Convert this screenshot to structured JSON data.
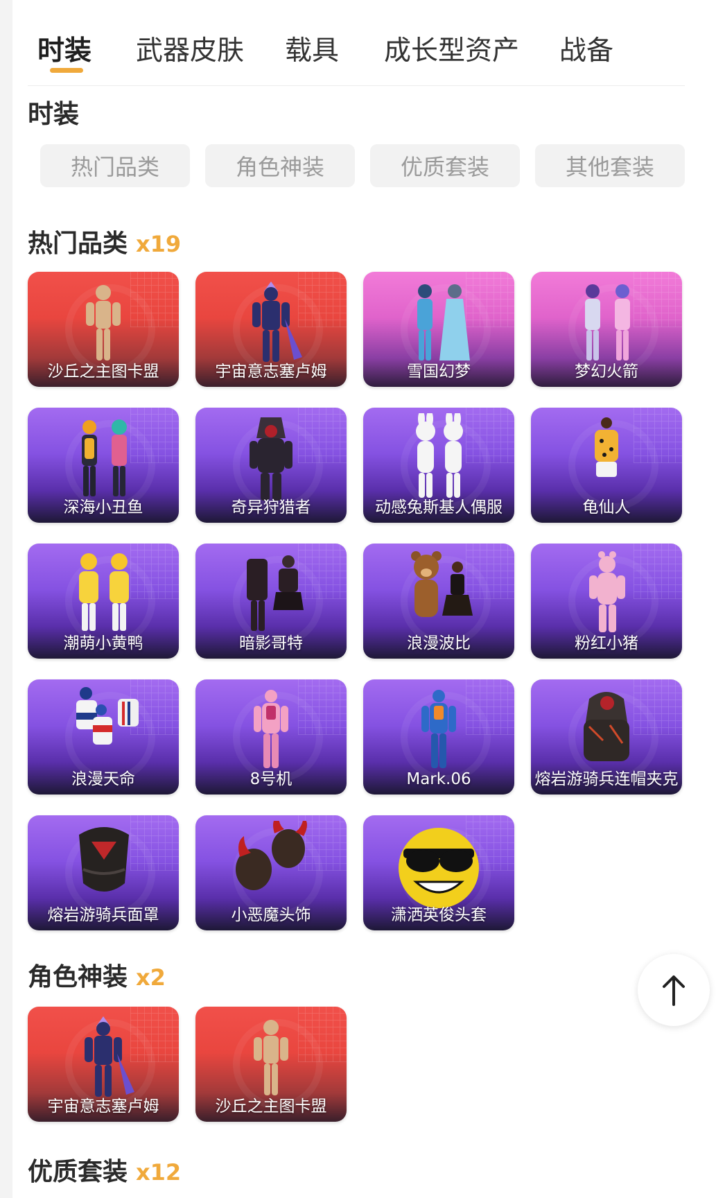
{
  "tabs": [
    {
      "label": "时装",
      "active": true
    },
    {
      "label": "武器皮肤"
    },
    {
      "label": "载具"
    },
    {
      "label": "成长型资产"
    },
    {
      "label": "战备"
    }
  ],
  "section_title": "时装",
  "filters": [
    "热门品类",
    "角色神装",
    "优质套装",
    "其他套装"
  ],
  "groups": [
    {
      "title": "热门品类",
      "count": "x19",
      "items": [
        {
          "label": "沙丘之主图卡盟",
          "theme": "red",
          "figure": "mummy"
        },
        {
          "label": "宇宙意志塞卢姆",
          "theme": "red",
          "figure": "armor"
        },
        {
          "label": "雪国幻梦",
          "theme": "pink",
          "figure": "pair-blue"
        },
        {
          "label": "梦幻火箭",
          "theme": "pink",
          "figure": "pair-pink"
        },
        {
          "label": "深海小丑鱼",
          "theme": "purple",
          "figure": "pair-orange"
        },
        {
          "label": "奇异狩猎者",
          "theme": "purple",
          "figure": "hunter"
        },
        {
          "label": "动感兔斯基人偶服",
          "theme": "purple",
          "figure": "bunnies"
        },
        {
          "label": "龟仙人",
          "theme": "purple",
          "figure": "hawaii"
        },
        {
          "label": "潮萌小黄鸭",
          "theme": "purple",
          "figure": "ducks"
        },
        {
          "label": "暗影哥特",
          "theme": "purple",
          "figure": "goth"
        },
        {
          "label": "浪漫波比",
          "theme": "purple",
          "figure": "bear"
        },
        {
          "label": "粉红小猪",
          "theme": "purple",
          "figure": "pig"
        },
        {
          "label": "浪漫天命",
          "theme": "purple",
          "figure": "sports"
        },
        {
          "label": "8号机",
          "theme": "purple",
          "figure": "mecha-pink"
        },
        {
          "label": "Mark.06",
          "theme": "purple",
          "figure": "mecha-blue"
        },
        {
          "label": "熔岩游骑兵连帽夹克",
          "theme": "purple",
          "figure": "hoodie"
        },
        {
          "label": "熔岩游骑兵面罩",
          "theme": "purple",
          "figure": "mask"
        },
        {
          "label": "小恶魔头饰",
          "theme": "purple",
          "figure": "horns"
        },
        {
          "label": "潇洒英俊头套",
          "theme": "purple",
          "figure": "smiley"
        }
      ]
    },
    {
      "title": "角色神装",
      "count": "x2",
      "items": [
        {
          "label": "宇宙意志塞卢姆",
          "theme": "red",
          "figure": "armor"
        },
        {
          "label": "沙丘之主图卡盟",
          "theme": "red",
          "figure": "mummy"
        }
      ]
    },
    {
      "title": "优质套装",
      "count": "x12",
      "items": []
    }
  ],
  "colors": {
    "accent": "#f0a93b",
    "red_card": "#e9463f",
    "pink_card": "#e063cb",
    "purple_card": "#8552e2"
  },
  "back_to_top_icon": "arrow-up-icon"
}
